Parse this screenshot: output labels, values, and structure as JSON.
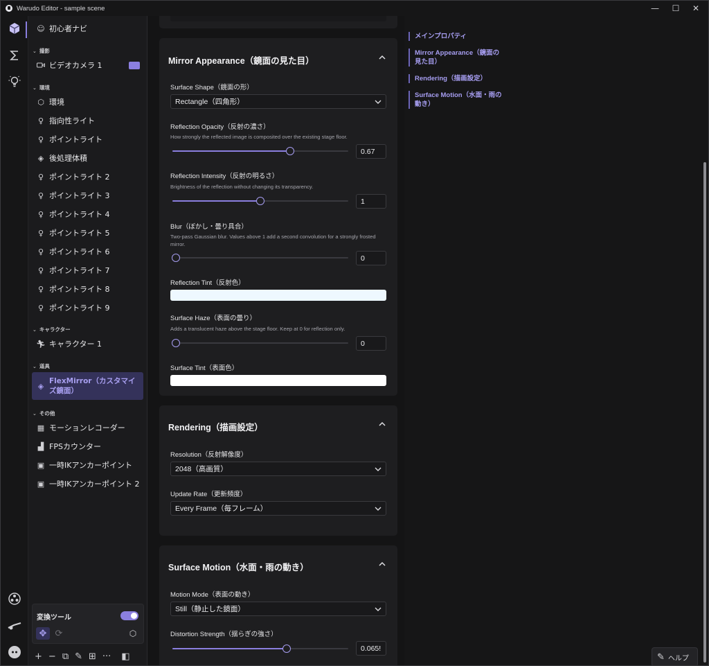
{
  "window": {
    "title": "Warudo Editor - sample scene",
    "minimize": "—",
    "maximize": "☐",
    "close": "✕"
  },
  "sidebar": {
    "top_item": "初心者ナビ",
    "groups": {
      "shoot": "撮影",
      "env": "環境",
      "char": "キャラクター",
      "props": "道具",
      "other": "その他"
    },
    "items": {
      "camera": "ビデオカメラ 1",
      "environment": "環境",
      "dirlight": "指向性ライト",
      "pointlight": "ポイントライト",
      "postfx": "後処理体積",
      "pl2": "ポイントライト 2",
      "pl3": "ポイントライト 3",
      "pl4": "ポイントライト 4",
      "pl5": "ポイントライト 5",
      "pl6": "ポイントライト 6",
      "pl7": "ポイントライト 7",
      "pl8": "ポイントライト 8",
      "pl9": "ポイントライト 9",
      "character": "キャラクター 1",
      "flexmirror": "FlexMirror（カスタマイズ鏡面）",
      "motionrec": "モーションレコーダー",
      "fps": "FPSカウンター",
      "ik1": "一時IKアンカーポイント",
      "ik2": "一時IKアンカーポイント 2"
    },
    "tools": {
      "label": "変換ツール",
      "toggle_on": true
    },
    "bottom": {
      "add": "+",
      "remove": "−",
      "more": "···"
    }
  },
  "mirror": {
    "title": "Mirror Appearance（鏡面の見た目）",
    "shape_label": "Surface Shape（鏡面の形）",
    "shape_value": "Rectangle（四角形）",
    "opacity_label": "Reflection Opacity（反射の濃さ）",
    "opacity_desc": "How strongly the reflected image is composited over the existing stage floor.",
    "opacity_value": "0.67",
    "opacity_level": 0.67,
    "intensity_label": "Reflection Intensity（反射の明るさ）",
    "intensity_desc": "Brightness of the reflection without changing its transparency.",
    "intensity_value": "1",
    "intensity_level": 0.5,
    "blur_label": "Blur（ぼかし・曇り具合）",
    "blur_desc": "Two-pass Gaussian blur. Values above 1 add a second convolution for a strongly frosted mirror.",
    "blur_value": "0",
    "blur_level": 0,
    "tint_label": "Reflection Tint（反射色）",
    "tint_color": "#eef8ff",
    "haze_label": "Surface Haze（表面の曇り）",
    "haze_desc": "Adds a translucent haze above the stage floor. Keep at 0 for reflection only.",
    "haze_value": "0",
    "haze_level": 0,
    "stint_label": "Surface Tint（表面色）",
    "stint_color": "#ffffff"
  },
  "rendering": {
    "title": "Rendering（描画設定）",
    "res_label": "Resolution（反射解像度）",
    "res_value": "2048（高画質）",
    "rate_label": "Update Rate（更新頻度）",
    "rate_value": "Every Frame（毎フレーム）"
  },
  "motion": {
    "title": "Surface Motion（水面・雨の動き）",
    "mode_label": "Motion Mode（表面の動き）",
    "mode_value": "Still（静止した鏡面）",
    "dist_label": "Distortion Strength（揺らぎの強さ）",
    "dist_value": "0.065!",
    "dist_level": 0.65
  },
  "toc": {
    "main": "メインプロパティ",
    "mirror": "Mirror Appearance（鏡面の見た目）",
    "rendering": "Rendering（描画設定）",
    "motion": "Surface Motion（水面・雨の動き）"
  },
  "help": "ヘルプ",
  "colors": {
    "accent": "#8b7fe0",
    "accent_text": "#a69df0",
    "panel": "#1e1e20"
  }
}
